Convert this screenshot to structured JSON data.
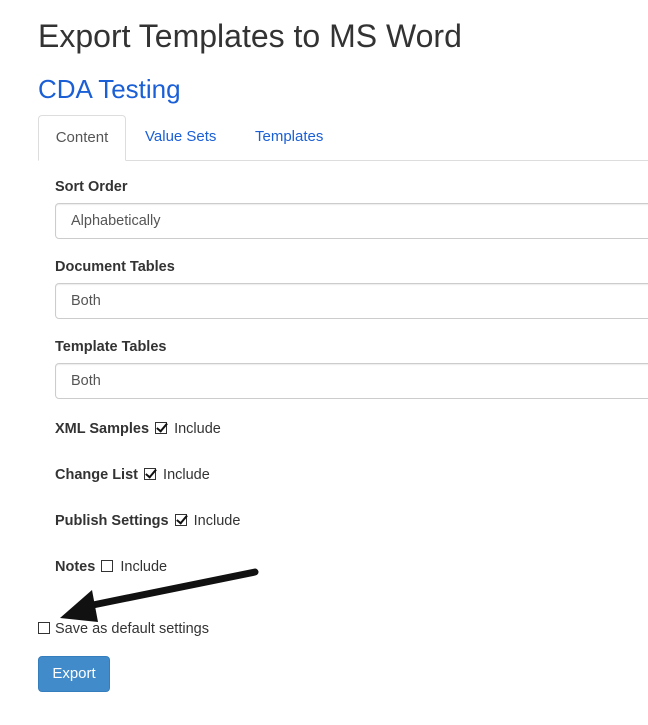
{
  "header": {
    "title": "Export Templates to MS Word",
    "project": "CDA Testing"
  },
  "tabs": [
    {
      "label": "Content",
      "active": true
    },
    {
      "label": "Value Sets",
      "active": false
    },
    {
      "label": "Templates",
      "active": false
    }
  ],
  "content": {
    "sort_order": {
      "label": "Sort Order",
      "value": "Alphabetically"
    },
    "document_tables": {
      "label": "Document Tables",
      "value": "Both"
    },
    "template_tables": {
      "label": "Template Tables",
      "value": "Both"
    },
    "xml_samples": {
      "label": "XML Samples",
      "option": "Include",
      "checked": true
    },
    "change_list": {
      "label": "Change List",
      "option": "Include",
      "checked": true
    },
    "publish_settings": {
      "label": "Publish Settings",
      "option": "Include",
      "checked": true
    },
    "notes": {
      "label": "Notes",
      "option": "Include",
      "checked": false
    }
  },
  "footer": {
    "save_default_label": "Save as default settings",
    "save_default_checked": false,
    "export_label": "Export"
  },
  "colors": {
    "link": "#1a5fd6",
    "primary_button": "#428bca",
    "annotation_arrow": "#111111"
  },
  "icons": {
    "annotation": "arrow-pointer-icon",
    "checkbox": "checkbox-icon"
  }
}
